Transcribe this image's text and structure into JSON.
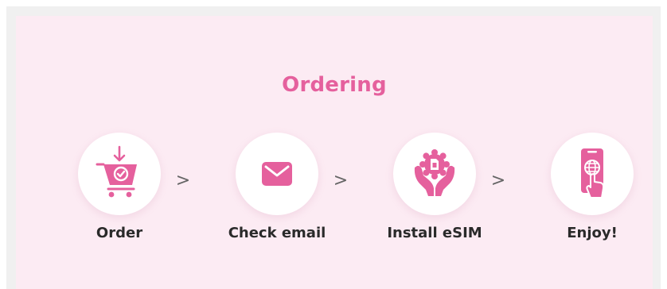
{
  "section": {
    "title": "Ordering"
  },
  "steps": [
    {
      "label": "Order",
      "icon": "shopping-cart-icon"
    },
    {
      "label": "Check email",
      "icon": "envelope-icon"
    },
    {
      "label": "Install eSIM",
      "icon": "hands-esim-icon"
    },
    {
      "label": "Enjoy!",
      "icon": "phone-globe-tap-icon"
    }
  ],
  "separator": ">",
  "colors": {
    "accent": "#e5609d",
    "panel_background": "#fcebf3",
    "label_text": "#2a2a2a"
  }
}
